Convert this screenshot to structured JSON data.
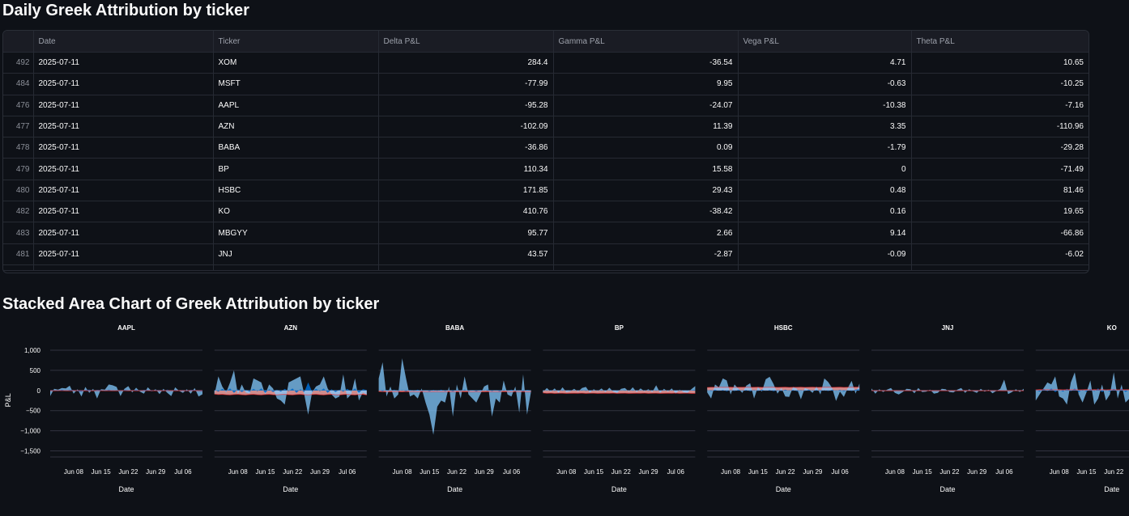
{
  "section_table": {
    "title": "Daily Greek Attribution by ticker"
  },
  "table": {
    "columns": [
      "",
      "Date",
      "Ticker",
      "Delta P&L",
      "Gamma P&L",
      "Vega P&L",
      "Theta P&L"
    ],
    "rows": [
      [
        "492",
        "2025-07-11",
        "XOM",
        "284.4",
        "-36.54",
        "4.71",
        "10.65"
      ],
      [
        "484",
        "2025-07-11",
        "MSFT",
        "-77.99",
        "9.95",
        "-0.63",
        "-10.25"
      ],
      [
        "476",
        "2025-07-11",
        "AAPL",
        "-95.28",
        "-24.07",
        "-10.38",
        "-7.16"
      ],
      [
        "477",
        "2025-07-11",
        "AZN",
        "-102.09",
        "11.39",
        "3.35",
        "-110.96"
      ],
      [
        "478",
        "2025-07-11",
        "BABA",
        "-36.86",
        "0.09",
        "-1.79",
        "-29.28"
      ],
      [
        "479",
        "2025-07-11",
        "BP",
        "110.34",
        "15.58",
        "0",
        "-71.49"
      ],
      [
        "480",
        "2025-07-11",
        "HSBC",
        "171.85",
        "29.43",
        "0.48",
        "81.46"
      ],
      [
        "482",
        "2025-07-11",
        "KO",
        "410.76",
        "-38.42",
        "0.16",
        "19.65"
      ],
      [
        "483",
        "2025-07-11",
        "MBGYY",
        "95.77",
        "2.66",
        "9.14",
        "-66.86"
      ],
      [
        "481",
        "2025-07-11",
        "JNJ",
        "43.57",
        "-2.87",
        "-0.09",
        "-6.02"
      ]
    ]
  },
  "section_chart": {
    "title": "Stacked Area Chart of Greek Attribution by ticker"
  },
  "chart_data": {
    "type": "area",
    "ylabel": "P&L",
    "xlabel": "Date",
    "yticks": [
      1000,
      500,
      0,
      -500,
      -1000,
      -1500
    ],
    "ytick_labels": [
      "1,000",
      "500",
      "0",
      "−500",
      "−1,000",
      "−1,500"
    ],
    "ylim": [
      -1650,
      1100
    ],
    "xticks": [
      "Jun 08",
      "Jun 15",
      "Jun 22",
      "Jun 29",
      "Jul 06"
    ],
    "xlim": [
      "2025-06-02",
      "2025-07-11"
    ],
    "grid": true,
    "colors": {
      "light": "#83c9ff",
      "dark": "#0068c9",
      "pink": "#ffabab",
      "red": "#ff2b2b"
    },
    "facets": [
      {
        "ticker": "AAPL",
        "delta": [
          -140,
          40,
          20,
          60,
          50,
          120,
          -80,
          30,
          -150,
          90,
          -60,
          40,
          -200,
          30,
          20,
          150,
          130,
          90,
          -140,
          40,
          110,
          -50,
          70,
          -30,
          -80,
          80,
          -20,
          30,
          -90,
          40,
          -60,
          -140,
          80,
          -10,
          -60,
          30,
          -80,
          60,
          -150,
          -95
        ],
        "dark": [
          5,
          10,
          -15,
          20,
          -10,
          15,
          10,
          -20,
          -30,
          10,
          20,
          -10,
          15,
          10,
          -15,
          20,
          -10,
          10,
          -20,
          15,
          5,
          -10,
          20,
          -10,
          15,
          10,
          -20,
          10,
          10,
          -15,
          20,
          -10,
          15,
          -10,
          10,
          -20,
          15,
          10,
          -10,
          -24
        ],
        "theta": [
          -5,
          -6,
          -4,
          -5,
          -7,
          -6,
          -5,
          -4,
          -6,
          -5,
          -7,
          -6,
          -5,
          -4,
          -6,
          -5,
          -7,
          -6,
          -5,
          -4,
          -6,
          -5,
          -7,
          -6,
          -5,
          -4,
          -6,
          -5,
          -7,
          -6,
          -5,
          -4,
          -6,
          -5,
          -7,
          -6,
          -5,
          -4,
          -6,
          -7
        ]
      },
      {
        "ticker": "AZN",
        "delta": [
          -100,
          350,
          100,
          -50,
          200,
          500,
          -100,
          150,
          -50,
          -80,
          300,
          250,
          200,
          -100,
          150,
          50,
          -200,
          -250,
          -350,
          200,
          250,
          300,
          350,
          -100,
          -600,
          -50,
          100,
          150,
          350,
          50,
          -100,
          -200,
          -150,
          400,
          -200,
          -100,
          300,
          -250,
          -50,
          -102
        ],
        "dark": [
          20,
          -30,
          40,
          -20,
          50,
          -60,
          30,
          -40,
          20,
          -30,
          40,
          -20,
          50,
          -60,
          30,
          -40,
          20,
          -30,
          40,
          -20,
          50,
          -60,
          30,
          -40,
          200,
          -30,
          40,
          -20,
          50,
          -60,
          30,
          -40,
          20,
          -30,
          40,
          -20,
          50,
          -60,
          30,
          11
        ],
        "theta": [
          -90,
          -100,
          -95,
          -105,
          -110,
          -100,
          -95,
          -105,
          -110,
          -100,
          -95,
          -105,
          -110,
          -100,
          -95,
          -105,
          -110,
          -100,
          -95,
          -105,
          -110,
          -100,
          -95,
          -105,
          -110,
          -100,
          -95,
          -105,
          -110,
          -100,
          -95,
          -105,
          -110,
          -100,
          -95,
          -105,
          -110,
          -100,
          -95,
          -111
        ]
      },
      {
        "ticker": "BABA",
        "delta": [
          300,
          700,
          -150,
          100,
          -200,
          -100,
          800,
          300,
          -150,
          -100,
          -200,
          50,
          -300,
          -600,
          -1100,
          -400,
          -250,
          -300,
          100,
          -650,
          150,
          -200,
          350,
          -100,
          -200,
          -300,
          -100,
          100,
          150,
          -650,
          -200,
          -300,
          250,
          -100,
          -150,
          100,
          -550,
          400,
          -600,
          -37
        ],
        "dark": [
          10,
          -20,
          15,
          -10,
          20,
          -15,
          10,
          -20,
          15,
          -10,
          20,
          -15,
          10,
          -20,
          15,
          -10,
          20,
          -15,
          10,
          -20,
          15,
          -10,
          20,
          -15,
          10,
          -20,
          15,
          -10,
          20,
          -15,
          10,
          -20,
          15,
          -10,
          20,
          -15,
          10,
          -20,
          15,
          0
        ],
        "theta": [
          -25,
          -30,
          -28,
          -32,
          -27,
          -29,
          -31,
          -26,
          -30,
          -28,
          -32,
          -27,
          -29,
          -31,
          -26,
          -30,
          -28,
          -32,
          -27,
          -29,
          -31,
          -26,
          -30,
          -28,
          -32,
          -27,
          -29,
          -31,
          -26,
          -30,
          -28,
          -32,
          -27,
          -29,
          -31,
          -26,
          -30,
          -28,
          -32,
          -29
        ]
      },
      {
        "ticker": "BP",
        "delta": [
          -40,
          60,
          -30,
          50,
          -60,
          80,
          -40,
          -20,
          40,
          -30,
          60,
          90,
          -50,
          30,
          -20,
          50,
          -40,
          70,
          -30,
          -60,
          40,
          60,
          -30,
          80,
          -40,
          50,
          -20,
          30,
          -40,
          130,
          -60,
          40,
          -30,
          50,
          -80,
          20,
          -40,
          -60,
          30,
          110
        ],
        "dark": [
          5,
          -5,
          8,
          -8,
          6,
          -6,
          7,
          -7,
          5,
          -5,
          8,
          -8,
          6,
          -6,
          7,
          -7,
          5,
          -5,
          8,
          -8,
          6,
          -6,
          7,
          -7,
          5,
          -5,
          8,
          -8,
          6,
          -6,
          7,
          -7,
          5,
          -5,
          8,
          -8,
          6,
          -6,
          7,
          16
        ],
        "theta": [
          -60,
          -70,
          -65,
          -72,
          -68,
          -66,
          -71,
          -69,
          -67,
          -70,
          -65,
          -72,
          -68,
          -66,
          -71,
          -69,
          -67,
          -70,
          -65,
          -72,
          -68,
          -66,
          -71,
          -69,
          -67,
          -70,
          -65,
          -72,
          -68,
          -66,
          -71,
          -69,
          -67,
          -70,
          -65,
          -72,
          -68,
          -66,
          -71,
          -71
        ]
      },
      {
        "ticker": "HSBC",
        "delta": [
          -50,
          -200,
          150,
          80,
          300,
          250,
          -100,
          150,
          40,
          -60,
          120,
          180,
          -200,
          90,
          -30,
          280,
          340,
          160,
          -80,
          60,
          -150,
          -160,
          90,
          40,
          -220,
          60,
          20,
          -60,
          100,
          -100,
          300,
          210,
          60,
          -260,
          -30,
          -160,
          60,
          240,
          -80,
          172
        ],
        "dark": [
          10,
          -15,
          20,
          -10,
          15,
          -20,
          10,
          -15,
          20,
          -10,
          15,
          -20,
          10,
          -15,
          20,
          -10,
          15,
          -20,
          10,
          -15,
          20,
          -10,
          15,
          -20,
          10,
          -15,
          20,
          -10,
          15,
          -20,
          10,
          -15,
          20,
          -10,
          15,
          -20,
          10,
          -15,
          20,
          29
        ],
        "theta": [
          75,
          80,
          78,
          82,
          77,
          79,
          81,
          76,
          80,
          78,
          82,
          77,
          79,
          81,
          76,
          80,
          78,
          82,
          77,
          79,
          81,
          76,
          80,
          78,
          82,
          77,
          79,
          81,
          76,
          80,
          78,
          82,
          77,
          79,
          81,
          76,
          80,
          78,
          82,
          81
        ]
      },
      {
        "ticker": "JNJ",
        "delta": [
          50,
          -80,
          30,
          -40,
          20,
          60,
          -60,
          -100,
          -40,
          40,
          30,
          -70,
          60,
          -40,
          -30,
          20,
          -80,
          -60,
          40,
          30,
          -40,
          -50,
          20,
          60,
          -60,
          30,
          -20,
          -60,
          40,
          -30,
          20,
          -70,
          -10,
          40,
          270,
          -90,
          -40,
          30,
          -40,
          44
        ],
        "dark": [
          5,
          -5,
          6,
          -6,
          5,
          -5,
          6,
          -6,
          5,
          -5,
          6,
          -6,
          5,
          -5,
          6,
          -6,
          5,
          -5,
          6,
          -6,
          5,
          -5,
          6,
          -6,
          5,
          -5,
          6,
          -6,
          5,
          -5,
          6,
          -6,
          5,
          -5,
          6,
          -6,
          5,
          -5,
          6,
          -3
        ],
        "theta": [
          -5,
          -6,
          -7,
          -5,
          -6,
          -7,
          -5,
          -6,
          -7,
          -5,
          -6,
          -7,
          -5,
          -6,
          -7,
          -5,
          -6,
          -7,
          -5,
          -6,
          -7,
          -5,
          -6,
          -7,
          -5,
          -6,
          -7,
          -5,
          -6,
          -7,
          -5,
          -6,
          -7,
          -5,
          -6,
          -7,
          -5,
          -6,
          -7,
          -6
        ]
      },
      {
        "ticker": "KO",
        "delta": [
          -250,
          -100,
          50,
          200,
          150,
          350,
          -150,
          -200,
          -350,
          200,
          450,
          -100,
          -300,
          -50,
          250,
          -350,
          -200,
          150,
          -250,
          -100,
          450,
          -200,
          150,
          -300,
          -200,
          -100,
          300,
          -250,
          150,
          -200,
          -100,
          250,
          -150,
          -100,
          200,
          -300,
          -100,
          200,
          -200,
          411
        ],
        "dark": [
          20,
          -30,
          40,
          -20,
          50,
          -40,
          20,
          -30,
          40,
          -20,
          50,
          -40,
          20,
          -30,
          40,
          -20,
          50,
          -40,
          20,
          -30,
          40,
          -20,
          50,
          -40,
          20,
          -30,
          40,
          -20,
          50,
          -40,
          20,
          -30,
          40,
          -20,
          50,
          -40,
          20,
          -30,
          40,
          -38
        ],
        "theta": [
          15,
          20,
          18,
          22,
          17,
          19,
          21,
          16,
          20,
          18,
          22,
          17,
          19,
          21,
          16,
          20,
          18,
          22,
          17,
          19,
          21,
          16,
          20,
          18,
          22,
          17,
          19,
          21,
          16,
          20,
          18,
          22,
          17,
          19,
          21,
          16,
          20,
          18,
          22,
          20
        ]
      }
    ]
  }
}
